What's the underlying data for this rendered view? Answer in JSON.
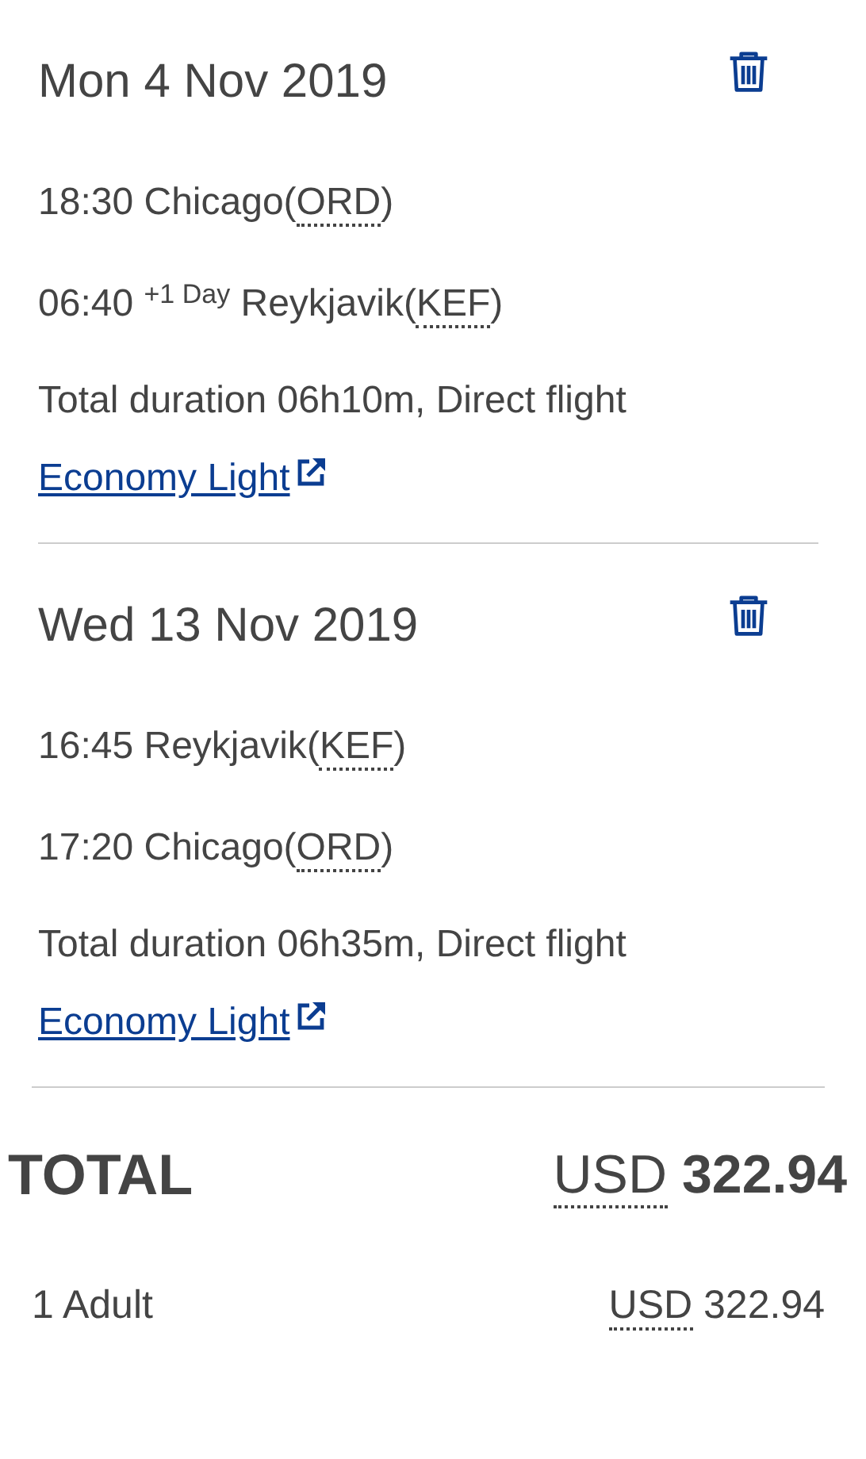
{
  "flights": [
    {
      "date": "Mon 4 Nov 2019",
      "segments": [
        {
          "time": "18:30",
          "city": "Chicago",
          "code": "(ORD)"
        },
        {
          "time": "06:40",
          "day_offset": "+1 Day",
          "city": "Reykjavik",
          "code": "(KEF)"
        }
      ],
      "duration": "Total duration 06h10m, Direct flight",
      "fare": "Economy Light"
    },
    {
      "date": "Wed 13 Nov 2019",
      "segments": [
        {
          "time": "16:45",
          "city": "Reykjavik",
          "code": "(KEF)"
        },
        {
          "time": "17:20",
          "city": "Chicago",
          "code": "(ORD)"
        }
      ],
      "duration": "Total duration 06h35m, Direct flight",
      "fare": "Economy Light"
    }
  ],
  "total": {
    "label": "TOTAL",
    "currency": "USD",
    "amount": "322.94"
  },
  "breakdown": [
    {
      "label": "1 Adult",
      "currency": "USD",
      "amount": "322.94"
    }
  ]
}
